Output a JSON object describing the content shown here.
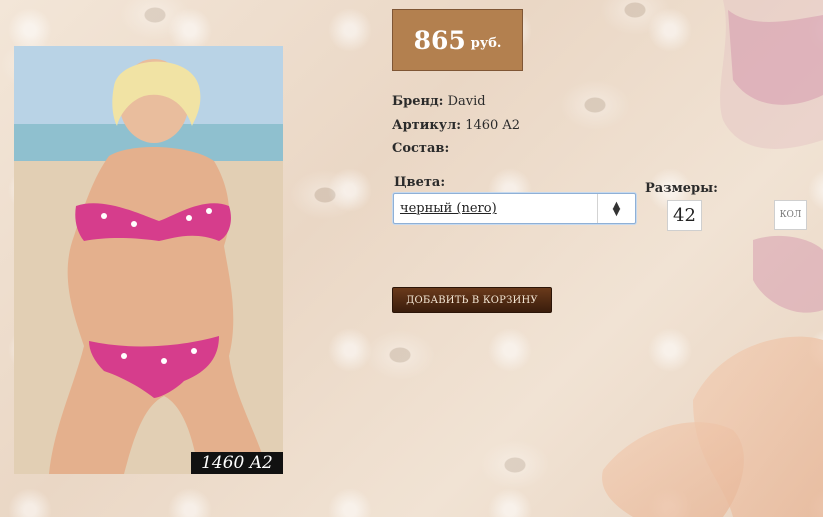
{
  "price": {
    "value": "865",
    "currency": "руб."
  },
  "specs": {
    "brand_label": "Бренд:",
    "brand_value": "David",
    "article_label": "Артикул:",
    "article_value": "1460 A2",
    "composition_label": "Состав:",
    "composition_value": ""
  },
  "colors": {
    "label": "Цвета:",
    "selected": "черный (nero)"
  },
  "sizes": {
    "label": "Размеры:",
    "selected": "42"
  },
  "size_chart_label": "КОЛ",
  "cart_button_label": "ДОБАВИТЬ В КОРЗИНУ",
  "photo": {
    "code": "1460 A2"
  },
  "accent_colors": {
    "price_bg": "#b3804f",
    "button_bg": "#4a2512",
    "swimsuit": "#d63d8c"
  }
}
